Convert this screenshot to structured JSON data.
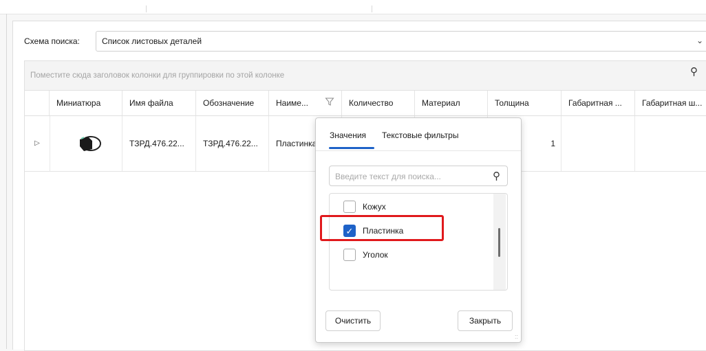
{
  "search_scheme": {
    "label": "Схема поиска:",
    "value": "Список листовых деталей"
  },
  "grid": {
    "group_hint": "Поместите сюда заголовок колонки для группировки по этой колонке",
    "columns": [
      "Миниатюра",
      "Имя файла",
      "Обозначение",
      "Наиме...",
      "Количество",
      "Материал",
      "Толщина",
      "Габаритная ...",
      "Габаритная ш..."
    ],
    "row": {
      "file_name": "ТЗРД.476.22...",
      "designation": "ТЗРД.476.22...",
      "name": "Пластинка",
      "quantity": "",
      "material": "",
      "thickness": "1"
    }
  },
  "filter_popup": {
    "tabs": [
      "Значения",
      "Текстовые фильтры"
    ],
    "active_tab": "Значения",
    "search_placeholder": "Введите текст для поиска...",
    "values": [
      {
        "label": "Кожух",
        "checked": false
      },
      {
        "label": "Пластинка",
        "checked": true
      },
      {
        "label": "Уголок",
        "checked": false
      }
    ],
    "clear_label": "Очистить",
    "close_label": "Закрыть"
  },
  "colors": {
    "accent": "#1e62c8",
    "highlight": "#e0191c"
  },
  "icons": [
    "search-icon",
    "chevron-down-icon",
    "filter-icon",
    "expand-row-icon",
    "check-icon",
    "resize-grip-icon"
  ]
}
